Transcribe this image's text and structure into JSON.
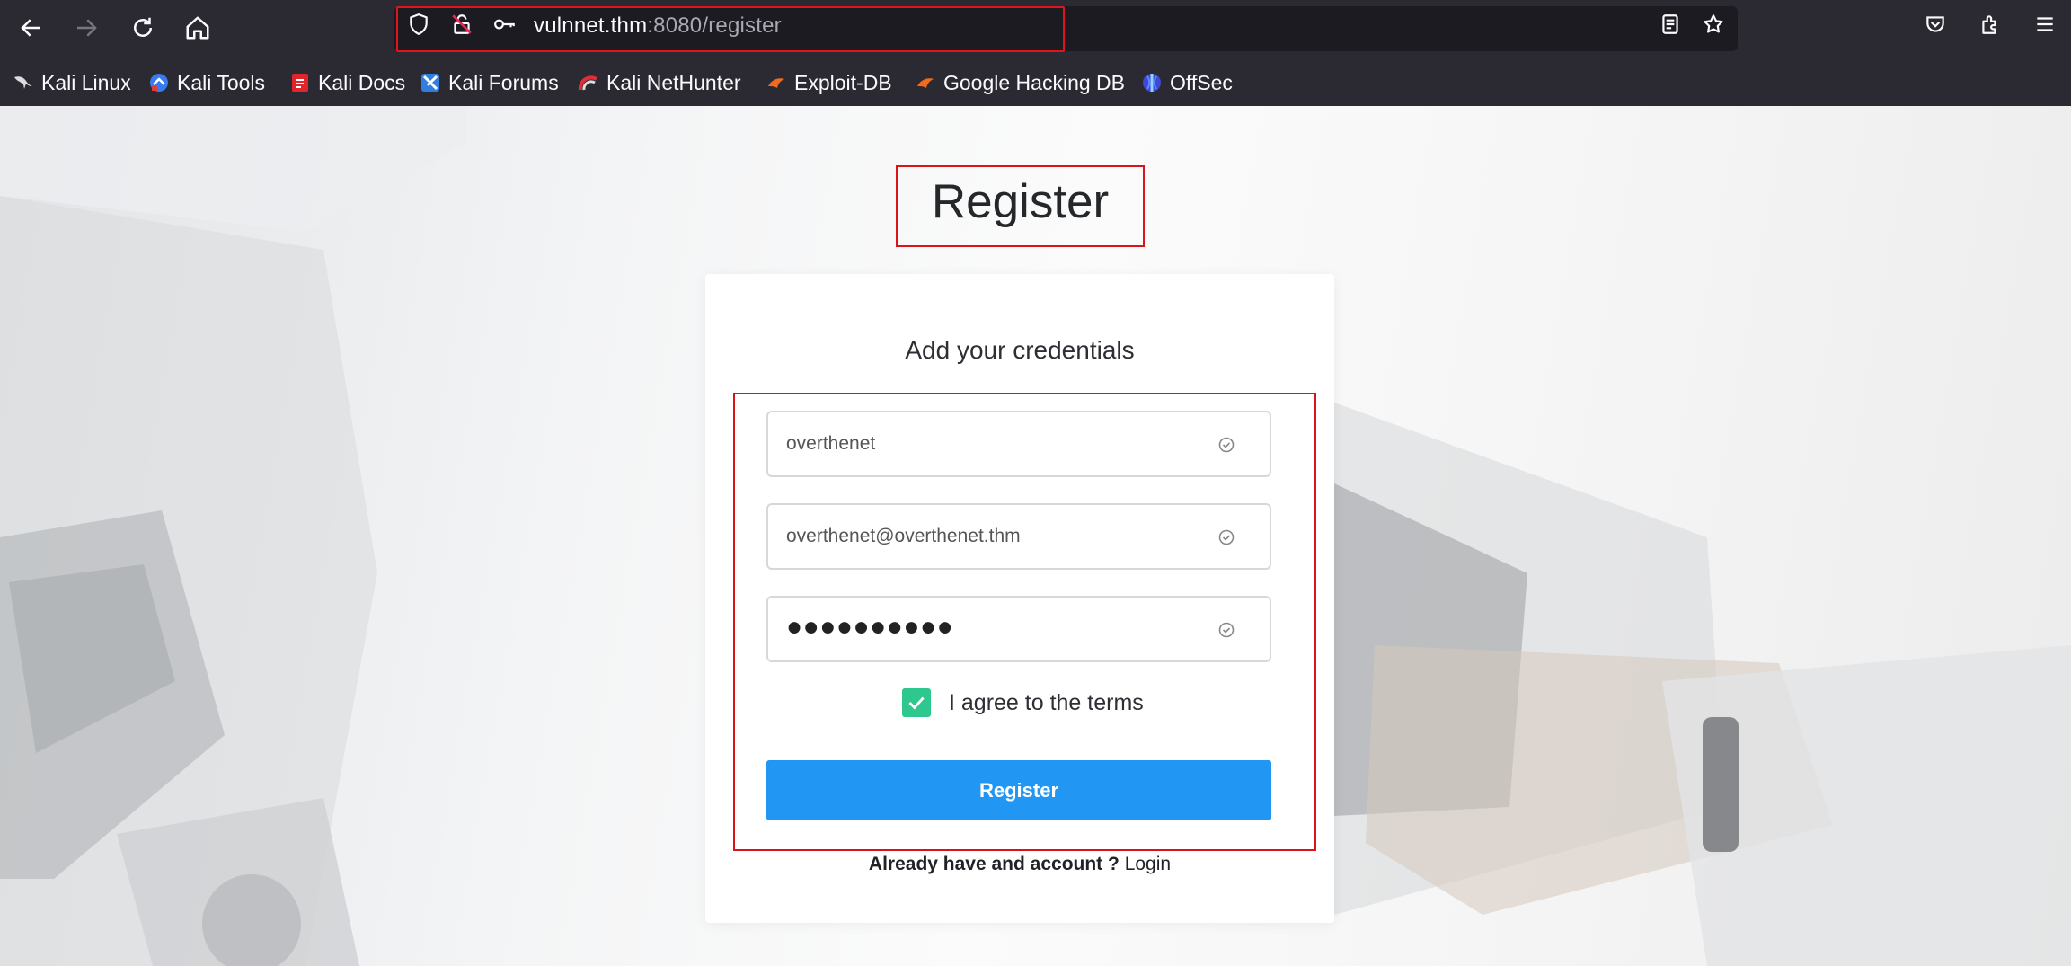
{
  "browser": {
    "url_host": "vulnnet.thm",
    "url_path": ":8080/register",
    "bookmarks": [
      {
        "label": "Kali Linux",
        "icon": "kali-dragon-icon"
      },
      {
        "label": "Kali Tools",
        "icon": "kali-tools-icon"
      },
      {
        "label": "Kali Docs",
        "icon": "kali-docs-icon"
      },
      {
        "label": "Kali Forums",
        "icon": "kali-forums-icon"
      },
      {
        "label": "Kali NetHunter",
        "icon": "kali-nethunter-icon"
      },
      {
        "label": "Exploit-DB",
        "icon": "exploit-db-icon"
      },
      {
        "label": "Google Hacking DB",
        "icon": "google-hacking-db-icon"
      },
      {
        "label": "OffSec",
        "icon": "offsec-icon"
      }
    ]
  },
  "page": {
    "heading": "Register",
    "subtitle": "Add your credentials",
    "username_value": "overthenet",
    "email_value": "overthenet@overthenet.thm",
    "password_mask": "●●●●●●●●●●",
    "agree_label": "I agree to the terms",
    "agree_checked": true,
    "submit_label": "Register",
    "already_text": "Already have and account ?",
    "login_link": "Login"
  },
  "colors": {
    "accent": "#2196f3",
    "checkbox": "#2ec88e",
    "annotation": "#d9141b"
  }
}
